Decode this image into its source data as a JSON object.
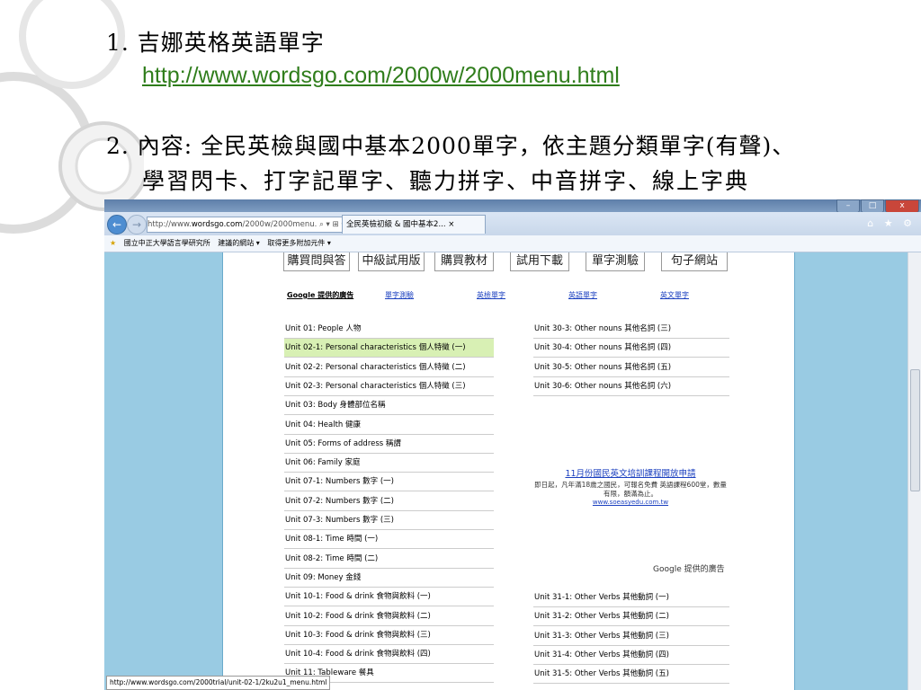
{
  "slide": {
    "item1_text": "1. 吉娜英格英語單字",
    "item1_link": "http://www.wordsgo.com/2000w/2000menu.html",
    "item2_line1": "2. 內容: 全民英檢與國中基本2000單字，依主題分類單字(有聲)、",
    "item2_line2": "學習閃卡、打字記單字、聽力拼字、中音拼字、線上字典"
  },
  "browser": {
    "window_buttons": [
      "–",
      "□",
      "x"
    ],
    "address_prefix": "http://www.",
    "address_domain": "wordsgo.com",
    "address_rest": "/2000w/2000menu. ⌕ ▾ ⊞ C ✕",
    "tab_label": "全民英檢初級 & 國中基本2...  ×",
    "right_icons": "⌂ ★ ⚙",
    "favorites": [
      "國立中正大學語言學研究所",
      "建議的網站 ▾",
      "取得更多附加元件 ▾"
    ],
    "status_url": "http://www.wordsgo.com/2000trial/unit-02-1/2ku2u1_menu.html"
  },
  "page": {
    "menu_buttons": [
      "購買問與答",
      "中級試用版",
      "購買教材",
      "試用下載",
      "單字測驗",
      "句子網站"
    ],
    "ad_label": "Google 提供的廣告",
    "ad_links": [
      "單字測驗",
      "英檢單字",
      "英語單字",
      "英文單字"
    ],
    "left_units": [
      "Unit 01: People 人物",
      "Unit 02-1: Personal characteristics 個人特徵 (一)",
      "Unit 02-2: Personal characteristics 個人特徵 (二)",
      "Unit 02-3: Personal characteristics 個人特徵 (三)",
      "Unit 03: Body 身體部位名稱",
      "Unit 04: Health 健康",
      "Unit 05: Forms of address 稱謂",
      "Unit 06: Family 家庭",
      "Unit 07-1: Numbers 數字 (一)",
      "Unit 07-2: Numbers 數字 (二)",
      "Unit 07-3: Numbers 數字 (三)",
      "Unit 08-1: Time 時間 (一)",
      "Unit 08-2: Time 時間 (二)",
      "Unit 09: Money 金錢",
      "Unit 10-1: Food & drink 食物與飲料 (一)",
      "Unit 10-2: Food & drink 食物與飲料 (二)",
      "Unit 10-3: Food & drink 食物與飲料 (三)",
      "Unit 10-4: Food & drink 食物與飲料 (四)",
      "Unit 11: Tableware 餐具"
    ],
    "right_units_top": [
      "Unit 30-3: Other nouns 其他名詞 (三)",
      "Unit 30-4: Other nouns 其他名詞 (四)",
      "Unit 30-5: Other nouns 其他名詞 (五)",
      "Unit 30-6: Other nouns 其他名詞 (六)"
    ],
    "right_units_bottom": [
      "Unit 31-1: Other Verbs 其他動詞 (一)",
      "Unit 31-2: Other Verbs 其他動詞 (二)",
      "Unit 31-3: Other Verbs 其他動詞 (三)",
      "Unit 31-4: Other Verbs 其他動詞 (四)",
      "Unit 31-5: Other Verbs 其他動詞 (五)"
    ],
    "ad_box": {
      "title": "11月份國民英文培訓課程開放申請",
      "body": "即日起，凡年滿18歲之國民，可報名免費 英語課程600堂，數量有限，額滿為止。",
      "url": "www.soeasyedu.com.tw"
    },
    "google_attribution": "Google 提供的廣告"
  },
  "colors": {
    "link_green": "#2f7d1b",
    "page_bg_blue": "#99cbe3",
    "highlight": "#d8f0b4"
  }
}
